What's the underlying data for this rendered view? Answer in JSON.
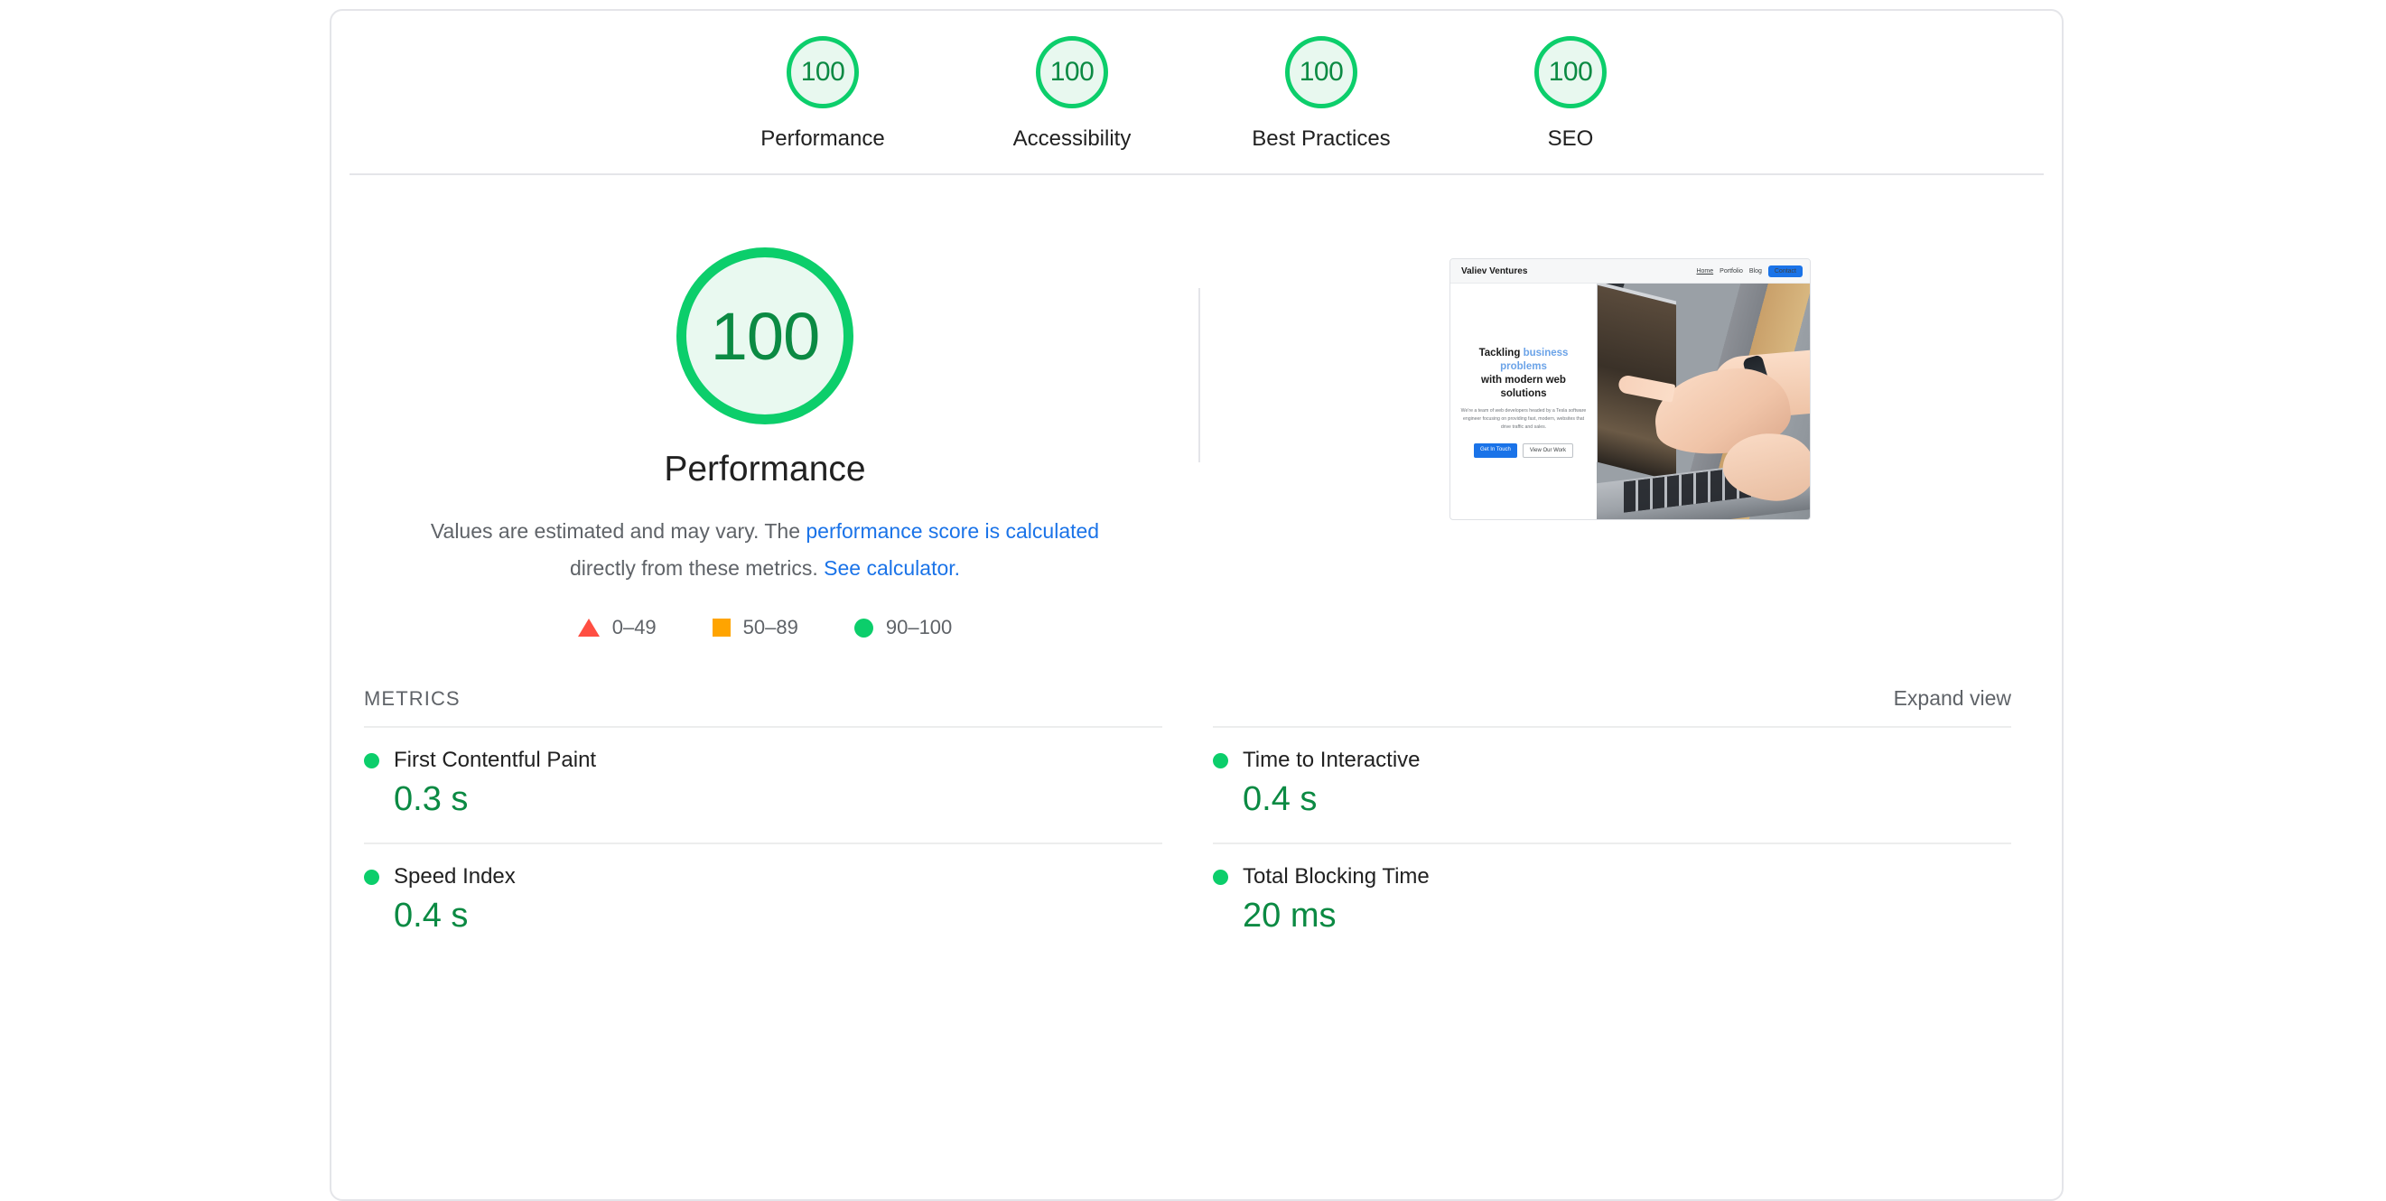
{
  "colors": {
    "pass": "#0cce6b",
    "pass_text": "#0b8a43",
    "average": "#ffa400",
    "fail": "#ff4e42",
    "link": "#1a73e8"
  },
  "category_gauges": [
    {
      "score": "100",
      "label": "Performance"
    },
    {
      "score": "100",
      "label": "Accessibility"
    },
    {
      "score": "100",
      "label": "Best Practices"
    },
    {
      "score": "100",
      "label": "SEO"
    }
  ],
  "hero": {
    "score": "100",
    "title": "Performance",
    "desc_part1": "Values are estimated and may vary. The ",
    "desc_link1": "performance score is calculated",
    "desc_part2": " directly from these metrics. ",
    "desc_link2": "See calculator.",
    "legend": [
      {
        "icon": "triangle-icon",
        "range": "0–49"
      },
      {
        "icon": "square-icon",
        "range": "50–89"
      },
      {
        "icon": "circle-icon",
        "range": "90–100"
      }
    ]
  },
  "thumbnail": {
    "brand": "Valiev Ventures",
    "nav": [
      "Home",
      "Portfolio",
      "Blog"
    ],
    "nav_button": "Contact",
    "headline_1": "Tackling ",
    "headline_em": "business problems",
    "headline_2": "with modern web solutions",
    "paragraph": "We're a team of web developers headed by a Tesla software engineer focusing on providing fast, modern, websites that drive traffic and sales.",
    "cta_primary": "Get In Touch",
    "cta_secondary": "View Our Work"
  },
  "metrics": {
    "section_title": "METRICS",
    "expand_label": "Expand view",
    "left": [
      {
        "name": "First Contentful Paint",
        "value": "0.3 s",
        "status": "pass"
      },
      {
        "name": "Speed Index",
        "value": "0.4 s",
        "status": "pass"
      }
    ],
    "right": [
      {
        "name": "Time to Interactive",
        "value": "0.4 s",
        "status": "pass"
      },
      {
        "name": "Total Blocking Time",
        "value": "20 ms",
        "status": "pass"
      }
    ]
  }
}
